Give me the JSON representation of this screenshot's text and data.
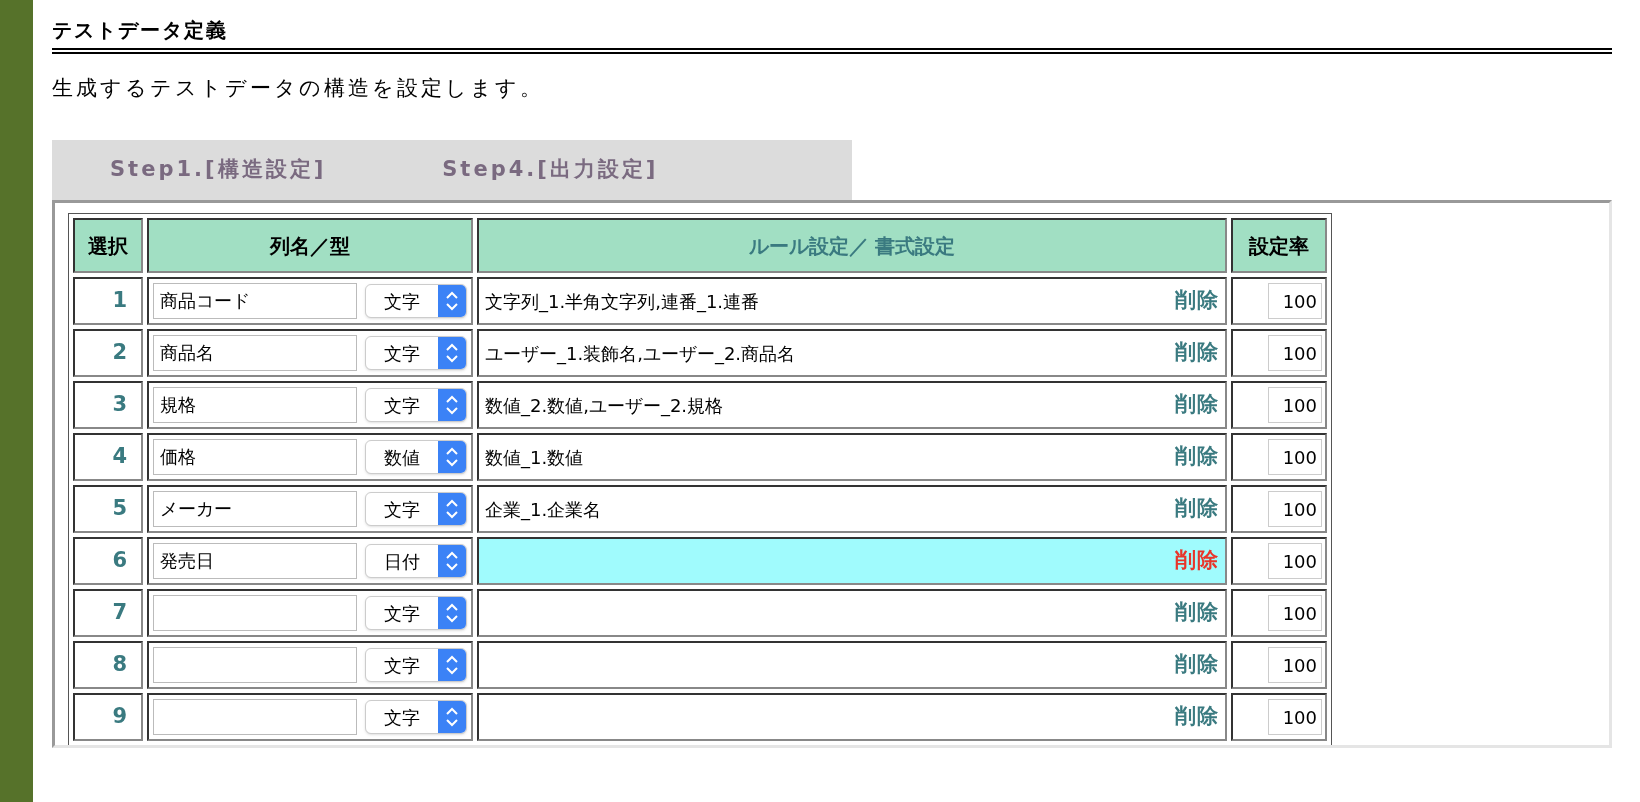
{
  "page": {
    "title": "テストデータ定義",
    "description": "生成するテストデータの構造を設定します。"
  },
  "tabs": [
    {
      "label": "Step1.[構造設定]"
    },
    {
      "label": "Step4.[出力設定]"
    }
  ],
  "table": {
    "columns": [
      "選択",
      "列名／型",
      "ルール設定／ 書式設定",
      "設定率"
    ],
    "rows": [
      {
        "number": "1",
        "name": "商品コード",
        "type": "文字",
        "rule": "文字列_1.半角文字列,連番_1.連番",
        "delete": "削除",
        "rate": "100",
        "selected": false
      },
      {
        "number": "2",
        "name": "商品名",
        "type": "文字",
        "rule": "ユーザー_1.装飾名,ユーザー_2.商品名",
        "delete": "削除",
        "rate": "100",
        "selected": false
      },
      {
        "number": "3",
        "name": "規格",
        "type": "文字",
        "rule": "数値_2.数値,ユーザー_2.規格",
        "delete": "削除",
        "rate": "100",
        "selected": false
      },
      {
        "number": "4",
        "name": "価格",
        "type": "数値",
        "rule": "数値_1.数値",
        "delete": "削除",
        "rate": "100",
        "selected": false
      },
      {
        "number": "5",
        "name": "メーカー",
        "type": "文字",
        "rule": "企業_1.企業名",
        "delete": "削除",
        "rate": "100",
        "selected": false
      },
      {
        "number": "6",
        "name": "発売日",
        "type": "日付",
        "delete": "削除",
        "rate": "100",
        "selected": true
      },
      {
        "number": "7",
        "type": "文字",
        "delete": "削除",
        "rate": "100",
        "selected": false
      },
      {
        "number": "8",
        "type": "文字",
        "delete": "削除",
        "rate": "100",
        "selected": false
      },
      {
        "number": "9",
        "type": "文字",
        "delete": "削除",
        "rate": "100",
        "selected": false
      }
    ]
  }
}
